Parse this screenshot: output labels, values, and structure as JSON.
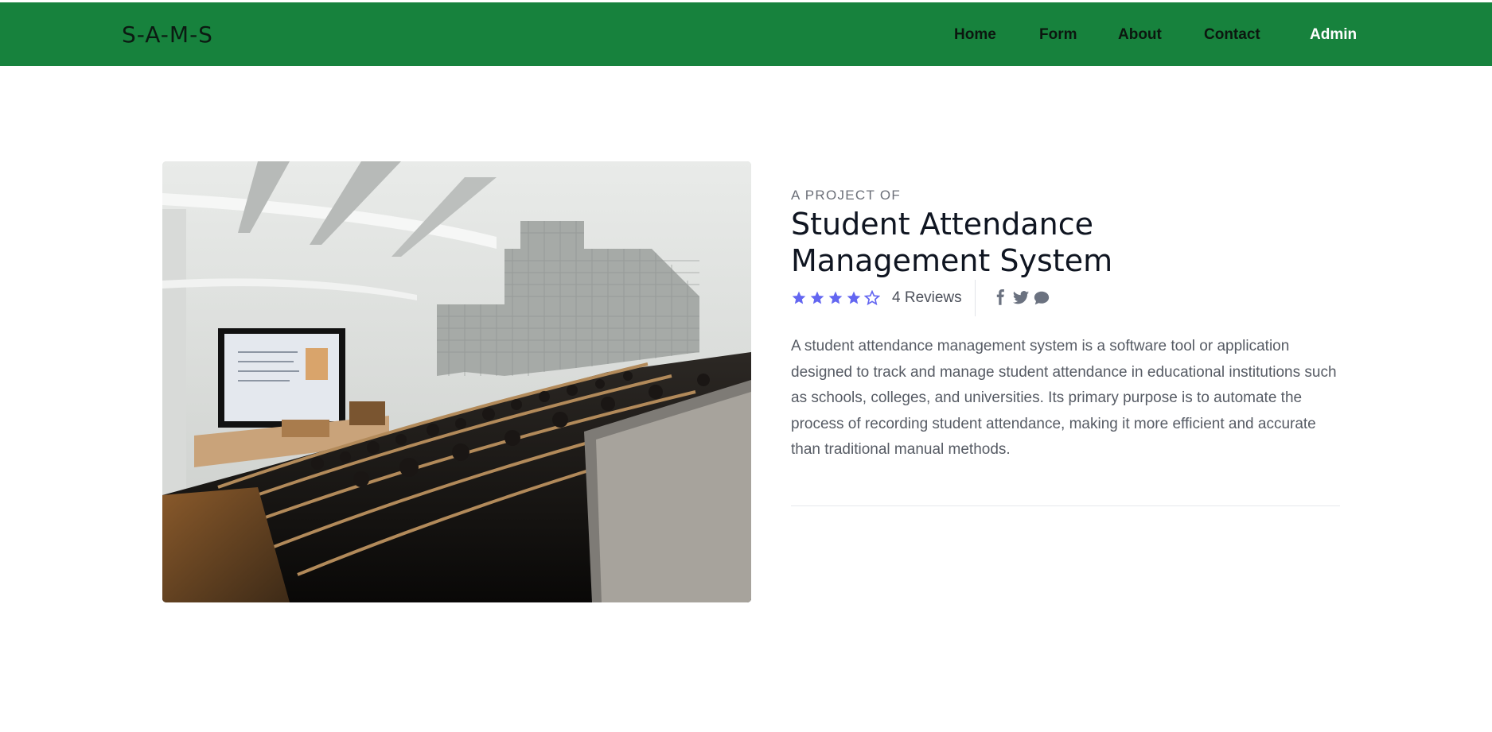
{
  "nav": {
    "brand": "S-A-M-S",
    "links": [
      {
        "label": "Home"
      },
      {
        "label": "Form"
      },
      {
        "label": "About"
      },
      {
        "label": "Contact"
      },
      {
        "label": "Admin"
      }
    ],
    "bg_color": "#17823d"
  },
  "hero": {
    "image_icon": "lecture-hall-photo"
  },
  "project": {
    "subtitle": "A PROJECT OF",
    "title": "Student Attendance Management System",
    "rating": {
      "value": 4,
      "max": 5,
      "star_color": "#6366f1"
    },
    "reviews_text": "4 Reviews",
    "socials": [
      "facebook-icon",
      "twitter-icon",
      "chat-icon"
    ],
    "description": "A student attendance management system is a software tool or application designed to track and manage student attendance in educational institutions such as schools, colleges, and universities. Its primary purpose is to automate the process of recording student attendance, making it more efficient and accurate than traditional manual methods."
  }
}
